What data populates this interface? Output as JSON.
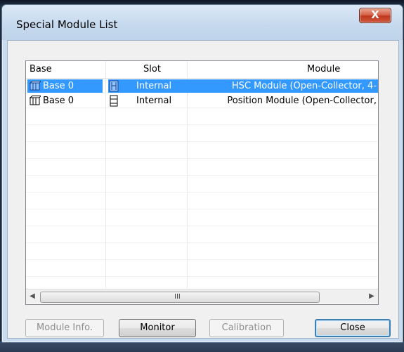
{
  "window": {
    "title": "Special Module List",
    "close_glyph": "X"
  },
  "list": {
    "columns": [
      "Base",
      "Slot",
      "Module"
    ],
    "rows": [
      {
        "base": "Base 0",
        "slot": "Internal",
        "module": "HSC Module (Open-Collector, 4-",
        "selected": true
      },
      {
        "base": "Base 0",
        "slot": "Internal",
        "module": "Position Module (Open-Collector,",
        "selected": false
      }
    ],
    "scrollbar_grip": "III"
  },
  "buttons": {
    "module_info": "Module Info.",
    "monitor": "Monitor",
    "calibration": "Calibration",
    "close": "Close"
  },
  "colors": {
    "selection": "#3399ff",
    "title_bar": "#c5d9ee",
    "close_button": "#c0381f"
  },
  "icons": {
    "base": "base-module-icon",
    "slot": "slot-icon"
  }
}
